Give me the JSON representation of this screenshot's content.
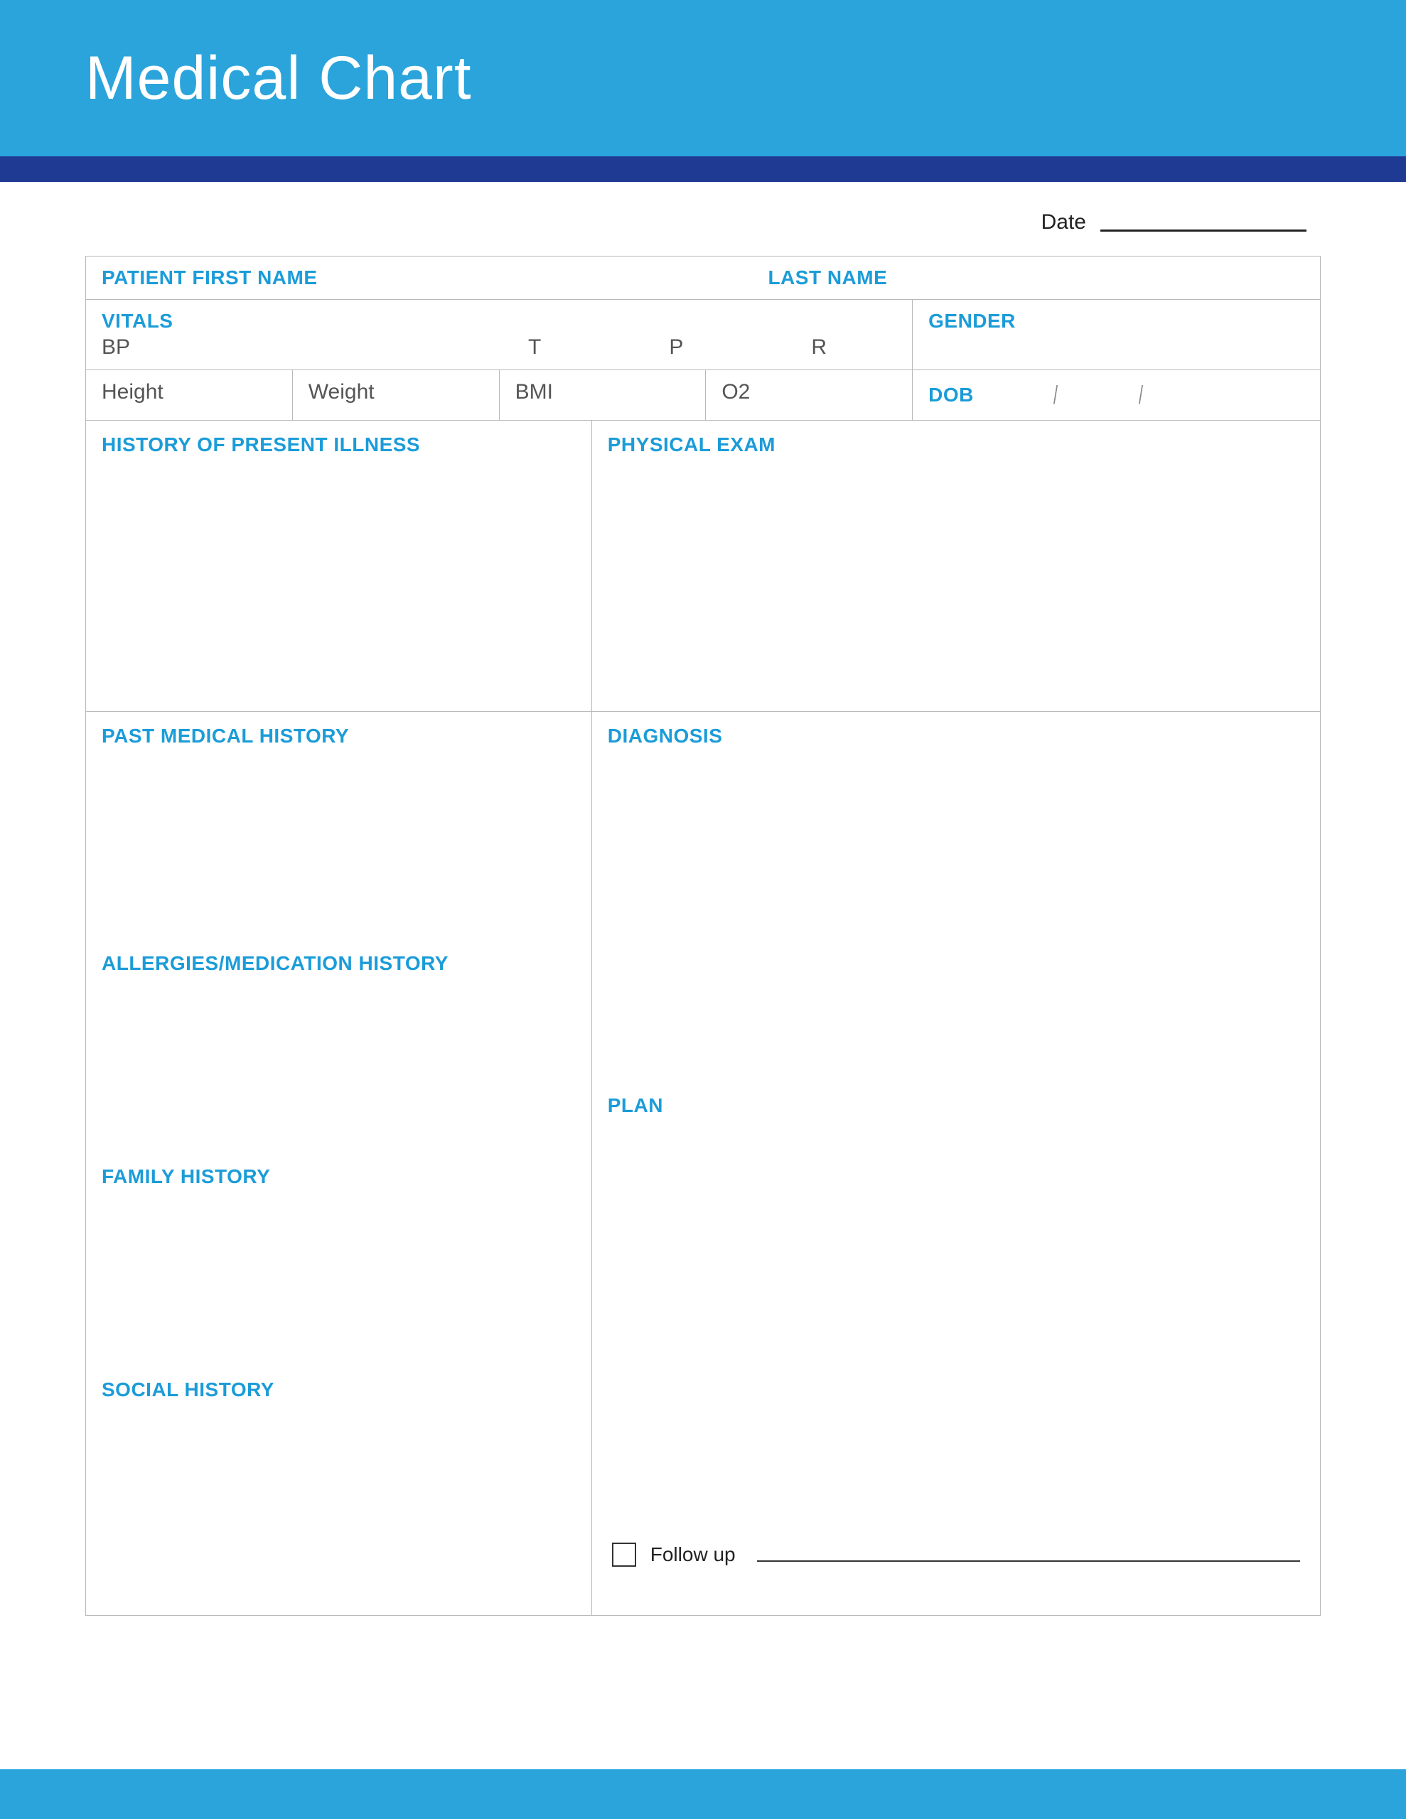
{
  "title": "Medical Chart",
  "date_label": "Date",
  "patient": {
    "first_name_label": "PATIENT FIRST NAME",
    "last_name_label": "LAST NAME"
  },
  "vitals": {
    "header": "VITALS",
    "bp": "BP",
    "t": "T",
    "p": "P",
    "r": "R",
    "height": "Height",
    "weight": "Weight",
    "bmi": "BMI",
    "o2": "O2"
  },
  "gender_label": "GENDER",
  "dob_label": "DOB",
  "sections": {
    "hpi": "HISTORY OF PRESENT ILLNESS",
    "pe": "PHYSICAL EXAM",
    "pmh": "PAST MEDICAL HISTORY",
    "dx": "DIAGNOSIS",
    "amh": "ALLERGIES/MEDICATION HISTORY",
    "plan": "PLAN",
    "fh": "FAMILY HISTORY",
    "sh": "SOCIAL HISTORY"
  },
  "followup_label": "Follow up"
}
